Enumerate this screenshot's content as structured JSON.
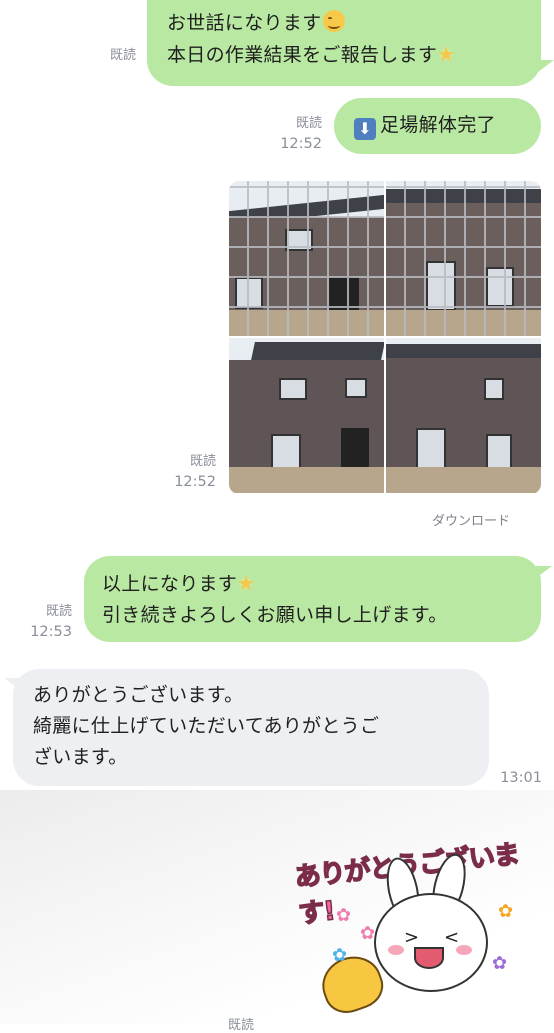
{
  "messages": {
    "m1": {
      "line1": "お世話になります",
      "line2": "本日の作業結果をご報告します",
      "read": "既読"
    },
    "m2": {
      "text": "足場解体完了",
      "read": "既読",
      "time": "12:52"
    },
    "m3": {
      "read": "既読",
      "time": "12:52",
      "download": "ダウンロード"
    },
    "m4": {
      "line1": "以上になります",
      "line2": "引き続きよろしくお願い申し上げます。",
      "read": "既読",
      "time": "12:53"
    },
    "m5": {
      "line1": "ありがとうございます。",
      "line2": "綺麗に仕上げていただいてありがとうご",
      "line3": "ざいます。",
      "time": "13:01"
    },
    "sticker": {
      "text": "ありがとうございます!"
    },
    "partial_read": "既読"
  },
  "icons": {
    "smile": "smiling-face-icon",
    "star": "star-icon",
    "down": "down-arrow-icon"
  },
  "colors": {
    "outgoing_bubble": "#b9e8a2",
    "incoming_bubble": "#eeeff2"
  }
}
